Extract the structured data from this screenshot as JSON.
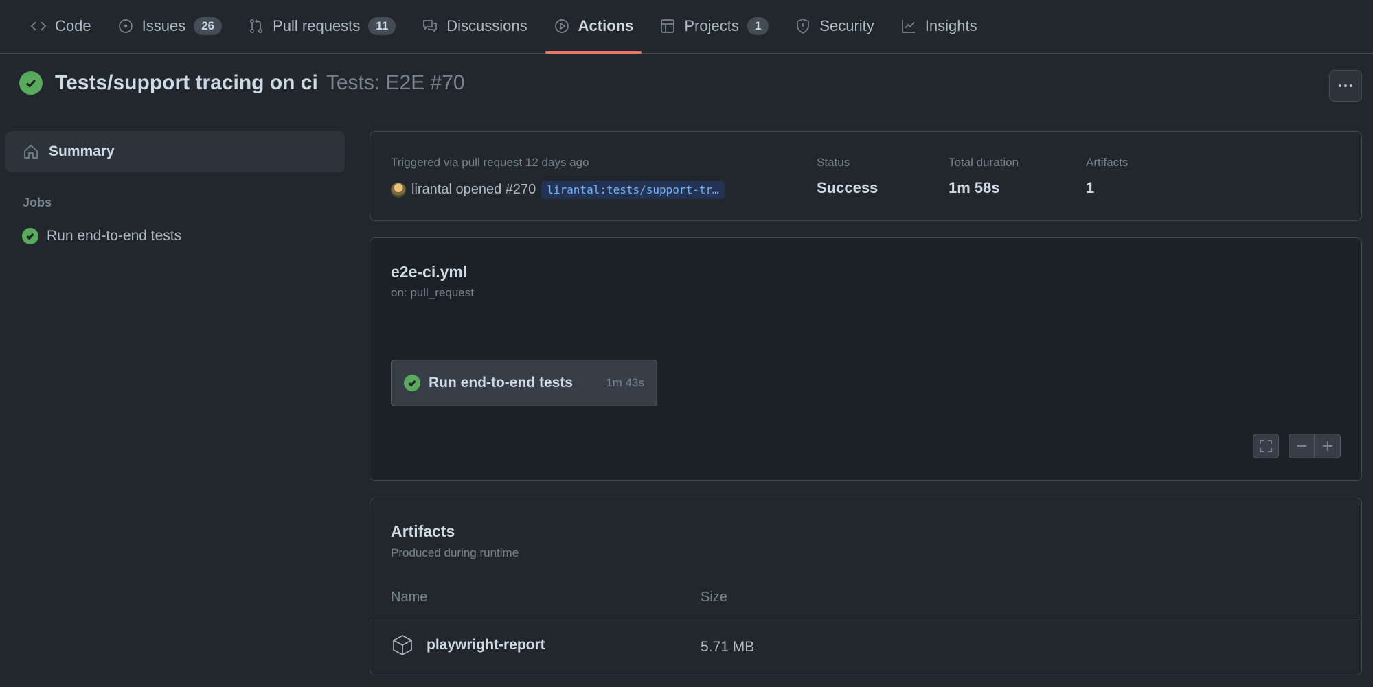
{
  "nav": {
    "items": [
      {
        "label": "Code",
        "icon": "code-icon"
      },
      {
        "label": "Issues",
        "icon": "issue-opened-icon",
        "count": "26"
      },
      {
        "label": "Pull requests",
        "icon": "git-pull-request-icon",
        "count": "11"
      },
      {
        "label": "Discussions",
        "icon": "comment-discussion-icon"
      },
      {
        "label": "Actions",
        "icon": "play-icon",
        "active": true
      },
      {
        "label": "Projects",
        "icon": "table-icon",
        "count": "1"
      },
      {
        "label": "Security",
        "icon": "shield-icon"
      },
      {
        "label": "Insights",
        "icon": "graph-icon"
      }
    ]
  },
  "run": {
    "title": "Tests/support tracing on ci",
    "subtitle": "Tests: E2E #70",
    "status_icon": "check-circle-fill-icon"
  },
  "sidebar": {
    "summary_label": "Summary",
    "jobs_heading": "Jobs",
    "jobs": [
      {
        "label": "Run end-to-end tests"
      }
    ]
  },
  "info": {
    "trigger_text": "Triggered via pull request 12 days ago",
    "actor_text": "lirantal opened #270",
    "branch": "lirantal:tests/support-tr…",
    "status_label": "Status",
    "status_value": "Success",
    "duration_label": "Total duration",
    "duration_value": "1m 58s",
    "artifacts_label": "Artifacts",
    "artifacts_value": "1"
  },
  "workflow": {
    "file": "e2e-ci.yml",
    "trigger": "on: pull_request",
    "job_name": "Run end-to-end tests",
    "job_duration": "1m 43s"
  },
  "artifacts": {
    "title": "Artifacts",
    "subtitle": "Produced during runtime",
    "col_name": "Name",
    "col_size": "Size",
    "rows": [
      {
        "name": "playwright-report",
        "size": "5.71 MB"
      }
    ]
  },
  "colors": {
    "background": "#22272e",
    "success": "#57ab5a",
    "active_underline": "#ec775c",
    "link": "#6cb6ff"
  }
}
